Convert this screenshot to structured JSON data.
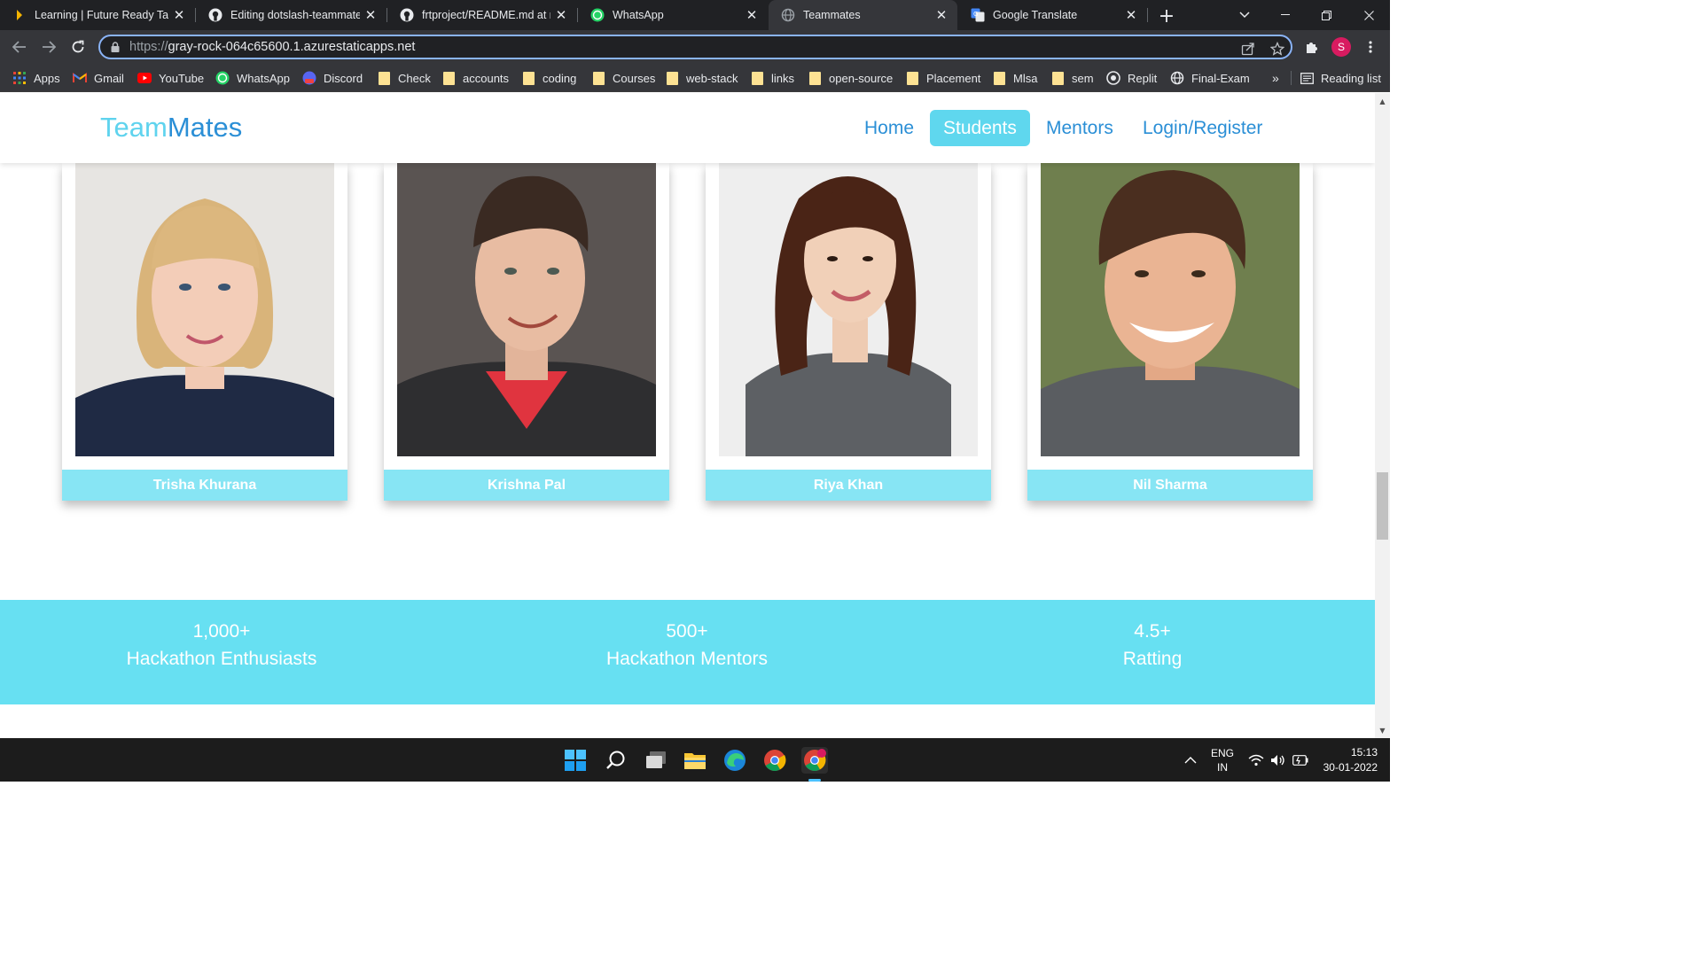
{
  "browser": {
    "tabs": [
      {
        "title": "Learning | Future Ready Talent",
        "icon": "learn-icon",
        "close": "✕"
      },
      {
        "title": "Editing dotslash-teammates",
        "icon": "github-icon",
        "close": "✕"
      },
      {
        "title": "frtproject/README.md at main",
        "icon": "github-icon",
        "close": "✕"
      },
      {
        "title": "WhatsApp",
        "icon": "whatsapp-icon",
        "close": "✕"
      },
      {
        "title": "Teammates",
        "icon": "globe-icon",
        "close": "✕"
      },
      {
        "title": "Google Translate",
        "icon": "translate-icon",
        "close": "✕"
      }
    ],
    "new_tab": "+",
    "url_scheme": "https://",
    "url_host": "gray-rock-064c65600.1.azurestaticapps.net",
    "profile_initial": "S",
    "bookmarks": [
      {
        "label": "Apps",
        "icon": "apps-grid-icon"
      },
      {
        "label": "Gmail",
        "icon": "gmail-icon"
      },
      {
        "label": "YouTube",
        "icon": "youtube-icon"
      },
      {
        "label": "WhatsApp",
        "icon": "whatsapp-icon"
      },
      {
        "label": "Discord",
        "icon": "discord-icon"
      },
      {
        "label": "Check",
        "icon": "folder-icon"
      },
      {
        "label": "accounts",
        "icon": "folder-icon"
      },
      {
        "label": "coding",
        "icon": "folder-icon"
      },
      {
        "label": "Courses",
        "icon": "folder-icon"
      },
      {
        "label": "web-stack",
        "icon": "folder-icon"
      },
      {
        "label": "links",
        "icon": "folder-icon"
      },
      {
        "label": "open-source",
        "icon": "folder-icon"
      },
      {
        "label": "Placement",
        "icon": "folder-icon"
      },
      {
        "label": "Mlsa",
        "icon": "folder-icon"
      },
      {
        "label": "sem",
        "icon": "folder-icon"
      },
      {
        "label": "Replit",
        "icon": "replit-icon"
      },
      {
        "label": "Final-Exam",
        "icon": "globe-icon"
      }
    ],
    "more_bookmarks": "»",
    "reading_list": "Reading list"
  },
  "site": {
    "logo_part1": "Team",
    "logo_part2": "Mates",
    "nav": [
      "Home",
      "Students",
      "Mentors",
      "Login/Register"
    ],
    "active_nav": "Students",
    "students": [
      {
        "name": "Trisha Khurana"
      },
      {
        "name": "Krishna Pal"
      },
      {
        "name": "Riya Khan"
      },
      {
        "name": "Nil Sharma"
      }
    ],
    "stats": [
      {
        "value": "1,000+",
        "label": "Hackathon Enthusiasts"
      },
      {
        "value": "500+",
        "label": "Hackathon Mentors"
      },
      {
        "value": "4.5+",
        "label": "Ratting"
      }
    ],
    "colors": {
      "accent": "#5fd7ee",
      "brand_blue": "#2b8fd6",
      "name_bar": "#87e5f4",
      "stats_band": "#67e0f2"
    }
  },
  "taskbar": {
    "language": "ENG",
    "region": "IN",
    "time": "15:13",
    "date": "30-01-2022"
  }
}
